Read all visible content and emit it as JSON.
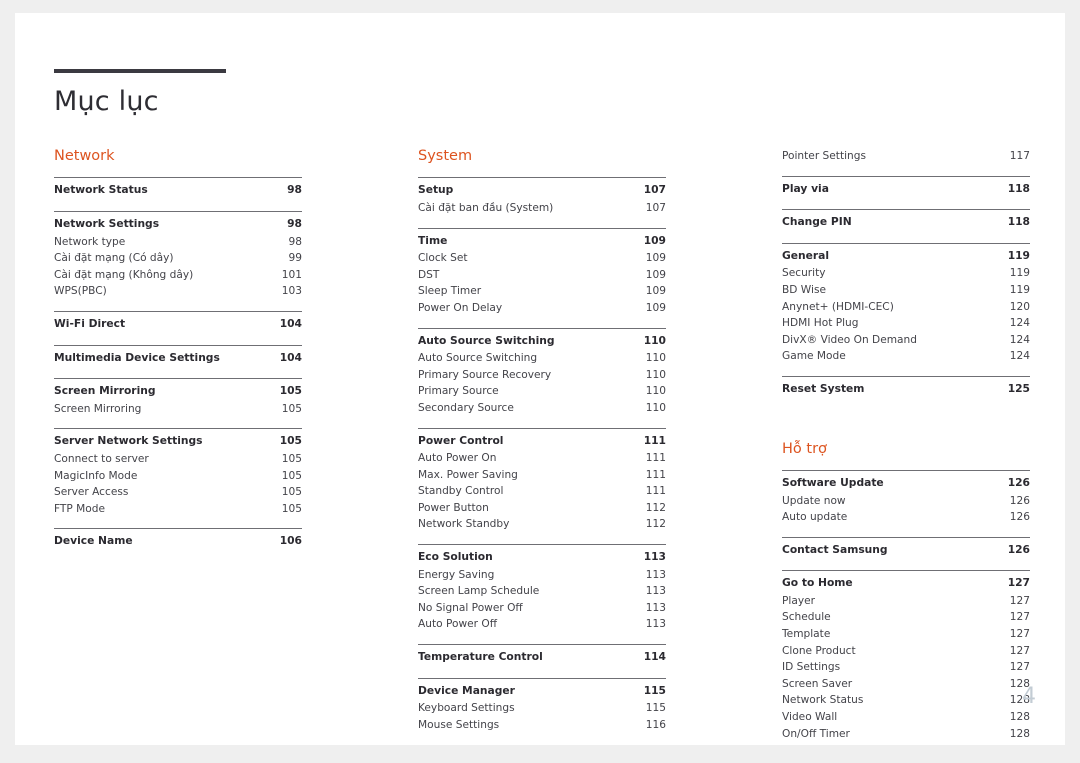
{
  "document": {
    "title": "Mục lục",
    "folio": "4",
    "accent_color": "#dd5420",
    "rule_color": "#6f6f74",
    "title_rule_color": "#3b3a41",
    "folio_color": "#c3ccd4"
  },
  "columns": [
    {
      "name": "column-one",
      "sections": [
        {
          "heading": "Network",
          "groups": [
            {
              "rule": true,
              "rows": [
                {
                  "label": "Network Status",
                  "page": "98",
                  "bold": true
                }
              ]
            },
            {
              "rule": true,
              "rows": [
                {
                  "label": "Network Settings",
                  "page": "98",
                  "bold": true
                },
                {
                  "label": "Network type",
                  "page": "98",
                  "bold": false
                },
                {
                  "label": "Cài đặt mạng (Có dây)",
                  "page": "99",
                  "bold": false
                },
                {
                  "label": "Cài đặt mạng (Không dây)",
                  "page": "101",
                  "bold": false
                },
                {
                  "label": "WPS(PBC)",
                  "page": "103",
                  "bold": false
                }
              ]
            },
            {
              "rule": true,
              "rows": [
                {
                  "label": "Wi-Fi Direct",
                  "page": "104",
                  "bold": true
                }
              ]
            },
            {
              "rule": true,
              "rows": [
                {
                  "label": "Multimedia Device Settings",
                  "page": "104",
                  "bold": true
                }
              ]
            },
            {
              "rule": true,
              "rows": [
                {
                  "label": "Screen Mirroring",
                  "page": "105",
                  "bold": true
                },
                {
                  "label": "Screen Mirroring",
                  "page": "105",
                  "bold": false
                }
              ]
            },
            {
              "rule": true,
              "rows": [
                {
                  "label": "Server Network Settings",
                  "page": "105",
                  "bold": true
                },
                {
                  "label": "Connect to server",
                  "page": "105",
                  "bold": false
                },
                {
                  "label": "MagicInfo Mode",
                  "page": "105",
                  "bold": false
                },
                {
                  "label": "Server Access",
                  "page": "105",
                  "bold": false
                },
                {
                  "label": "FTP Mode",
                  "page": "105",
                  "bold": false
                }
              ]
            },
            {
              "rule": true,
              "rows": [
                {
                  "label": "Device Name",
                  "page": "106",
                  "bold": true
                }
              ]
            }
          ]
        }
      ]
    },
    {
      "name": "column-two",
      "sections": [
        {
          "heading": "System",
          "groups": [
            {
              "rule": true,
              "rows": [
                {
                  "label": "Setup",
                  "page": "107",
                  "bold": true
                },
                {
                  "label": "Cài đặt ban đầu (System)",
                  "page": "107",
                  "bold": false
                }
              ]
            },
            {
              "rule": true,
              "rows": [
                {
                  "label": "Time",
                  "page": "109",
                  "bold": true
                },
                {
                  "label": "Clock Set",
                  "page": "109",
                  "bold": false
                },
                {
                  "label": "DST",
                  "page": "109",
                  "bold": false
                },
                {
                  "label": "Sleep Timer",
                  "page": "109",
                  "bold": false
                },
                {
                  "label": "Power On Delay",
                  "page": "109",
                  "bold": false
                }
              ]
            },
            {
              "rule": true,
              "rows": [
                {
                  "label": "Auto Source Switching",
                  "page": "110",
                  "bold": true
                },
                {
                  "label": "Auto Source Switching",
                  "page": "110",
                  "bold": false
                },
                {
                  "label": "Primary Source Recovery",
                  "page": "110",
                  "bold": false
                },
                {
                  "label": "Primary Source",
                  "page": "110",
                  "bold": false
                },
                {
                  "label": "Secondary Source",
                  "page": "110",
                  "bold": false
                }
              ]
            },
            {
              "rule": true,
              "rows": [
                {
                  "label": "Power Control",
                  "page": "111",
                  "bold": true
                },
                {
                  "label": "Auto Power On",
                  "page": "111",
                  "bold": false
                },
                {
                  "label": "Max. Power Saving",
                  "page": "111",
                  "bold": false
                },
                {
                  "label": "Standby Control",
                  "page": "111",
                  "bold": false
                },
                {
                  "label": "Power Button",
                  "page": "112",
                  "bold": false
                },
                {
                  "label": "Network Standby",
                  "page": "112",
                  "bold": false
                }
              ]
            },
            {
              "rule": true,
              "rows": [
                {
                  "label": "Eco Solution",
                  "page": "113",
                  "bold": true
                },
                {
                  "label": "Energy Saving",
                  "page": "113",
                  "bold": false
                },
                {
                  "label": "Screen Lamp Schedule",
                  "page": "113",
                  "bold": false
                },
                {
                  "label": "No Signal Power Off",
                  "page": "113",
                  "bold": false
                },
                {
                  "label": "Auto Power Off",
                  "page": "113",
                  "bold": false
                }
              ]
            },
            {
              "rule": true,
              "rows": [
                {
                  "label": "Temperature Control",
                  "page": "114",
                  "bold": true
                }
              ]
            },
            {
              "rule": true,
              "rows": [
                {
                  "label": "Device Manager",
                  "page": "115",
                  "bold": true
                },
                {
                  "label": "Keyboard Settings",
                  "page": "115",
                  "bold": false
                },
                {
                  "label": "Mouse Settings",
                  "page": "116",
                  "bold": false
                }
              ]
            }
          ]
        }
      ]
    },
    {
      "name": "column-three",
      "sections": [
        {
          "heading": "",
          "groups": [
            {
              "rule": false,
              "rows": [
                {
                  "label": "Pointer Settings",
                  "page": "117",
                  "bold": false
                }
              ]
            },
            {
              "rule": true,
              "rows": [
                {
                  "label": "Play via",
                  "page": "118",
                  "bold": true
                }
              ]
            },
            {
              "rule": true,
              "rows": [
                {
                  "label": "Change PIN",
                  "page": "118",
                  "bold": true
                }
              ]
            },
            {
              "rule": true,
              "rows": [
                {
                  "label": "General",
                  "page": "119",
                  "bold": true
                },
                {
                  "label": "Security",
                  "page": "119",
                  "bold": false
                },
                {
                  "label": "BD Wise",
                  "page": "119",
                  "bold": false
                },
                {
                  "label": "Anynet+ (HDMI-CEC)",
                  "page": "120",
                  "bold": false
                },
                {
                  "label": "HDMI Hot Plug",
                  "page": "124",
                  "bold": false
                },
                {
                  "label": "DivX® Video On Demand",
                  "page": "124",
                  "bold": false
                },
                {
                  "label": "Game Mode",
                  "page": "124",
                  "bold": false
                }
              ]
            },
            {
              "rule": true,
              "rows": [
                {
                  "label": "Reset System",
                  "page": "125",
                  "bold": true
                }
              ]
            }
          ]
        },
        {
          "heading": "Hỗ trợ",
          "spaced": true,
          "groups": [
            {
              "rule": true,
              "rows": [
                {
                  "label": "Software Update",
                  "page": "126",
                  "bold": true
                },
                {
                  "label": "Update now",
                  "page": "126",
                  "bold": false
                },
                {
                  "label": "Auto update",
                  "page": "126",
                  "bold": false
                }
              ]
            },
            {
              "rule": true,
              "rows": [
                {
                  "label": "Contact Samsung",
                  "page": "126",
                  "bold": true
                }
              ]
            },
            {
              "rule": true,
              "rows": [
                {
                  "label": "Go to Home",
                  "page": "127",
                  "bold": true
                },
                {
                  "label": "Player",
                  "page": "127",
                  "bold": false
                },
                {
                  "label": "Schedule",
                  "page": "127",
                  "bold": false
                },
                {
                  "label": "Template",
                  "page": "127",
                  "bold": false
                },
                {
                  "label": "Clone Product",
                  "page": "127",
                  "bold": false
                },
                {
                  "label": "ID Settings",
                  "page": "127",
                  "bold": false
                },
                {
                  "label": "Screen Saver",
                  "page": "128",
                  "bold": false
                },
                {
                  "label": "Network Status",
                  "page": "128",
                  "bold": false
                },
                {
                  "label": "Video Wall",
                  "page": "128",
                  "bold": false
                },
                {
                  "label": "On/Off Timer",
                  "page": "128",
                  "bold": false
                }
              ]
            }
          ]
        }
      ]
    }
  ]
}
